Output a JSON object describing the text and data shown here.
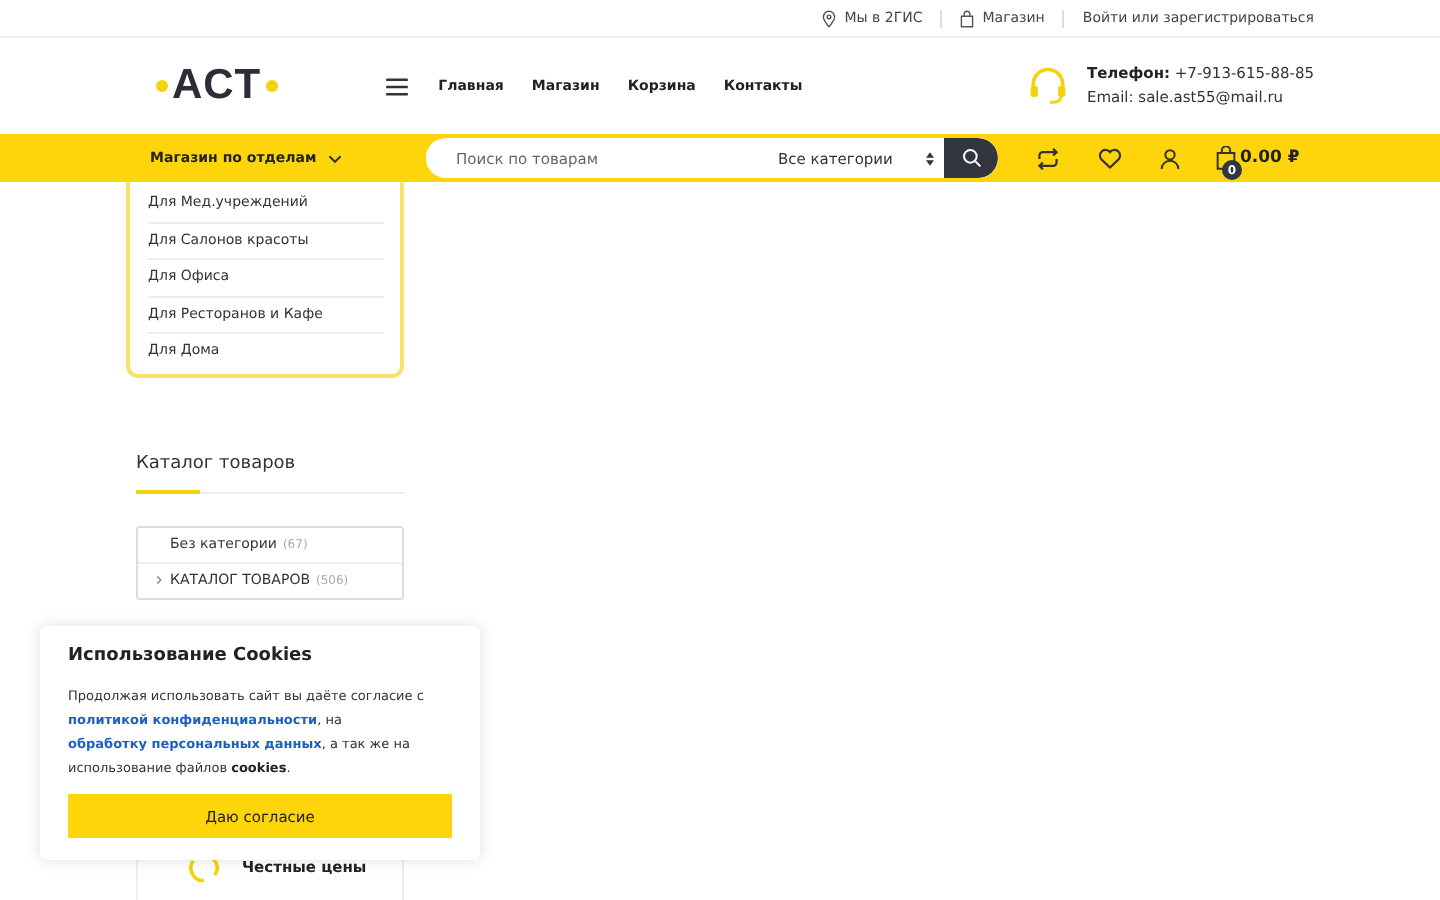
{
  "topbar": {
    "items": [
      {
        "kind": "map",
        "label": "Мы в 2ГИС"
      },
      {
        "kind": "shop",
        "label": "Магазин"
      },
      {
        "kind": "plain",
        "label": "Войти или зарегистрироваться"
      }
    ]
  },
  "header": {
    "logo": "АСТ",
    "nav": [
      "Главная",
      "Магазин",
      "Корзина",
      "Контакты"
    ],
    "phone_label": "Телефон:",
    "phone": "+7-913-615-88-85",
    "email": "Email: sale.ast55@mail.ru"
  },
  "bar": {
    "departments": "Магазин по отделам",
    "search": {
      "placeholder": "Поиск по товарам",
      "category": "Все категории"
    },
    "cart_count": "0",
    "cart_total": "0.00 ₽"
  },
  "departments": [
    "Для Мед.учреждений",
    "Для Салонов красоты",
    "Для Офиса",
    "Для Ресторанов и Кафе",
    "Для Дома"
  ],
  "catalog": {
    "title": "Каталог товаров",
    "items": [
      {
        "label": "Без категории",
        "count": "(67)",
        "has_children": false
      },
      {
        "label": "КАТАЛОГ ТОВАРОВ",
        "count": "(506)",
        "has_children": true
      }
    ]
  },
  "features": [
    {
      "label": "Честные цены"
    }
  ],
  "cookie": {
    "title": "Использование Cookies",
    "body": [
      {
        "kind": "text",
        "text": "Продолжая использовать сайт вы даёте согласие с "
      },
      {
        "kind": "link",
        "text": "политикой конфиденциальности"
      },
      {
        "kind": "text",
        "text": ", на "
      },
      {
        "kind": "link",
        "text": "обработку персональных данных"
      },
      {
        "kind": "text",
        "text": ", а так же на использование файлов "
      },
      {
        "kind": "bold",
        "text": "cookies"
      },
      {
        "kind": "text",
        "text": "."
      }
    ],
    "button": "Даю согласие"
  }
}
